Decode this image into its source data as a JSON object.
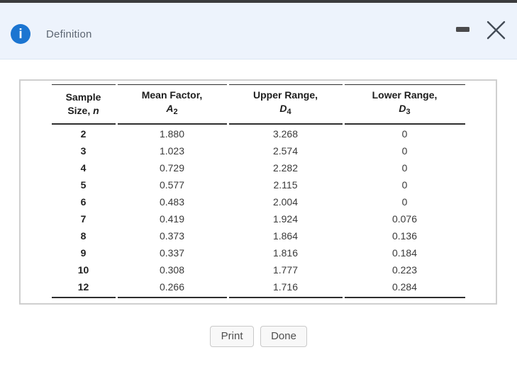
{
  "dialog": {
    "title": "Definition"
  },
  "window_controls": {
    "minimize_icon": "minimize-dash",
    "close_icon": "close-x"
  },
  "buttons": {
    "print_label": "Print",
    "done_label": "Done"
  },
  "colors": {
    "accent_blue": "#1b75d1",
    "header_band": "#edf3fc",
    "top_bar": "#3b3b3d",
    "table_rule": "#2e2e2e",
    "panel_border": "#cfcfcf",
    "button_text": "#4f4f4f"
  },
  "table": {
    "columns": [
      {
        "line1": "Sample",
        "line2_text": "Size, ",
        "symbol": "n",
        "subscript": ""
      },
      {
        "line1": "Mean Factor,",
        "line2_text": "",
        "symbol": "A",
        "subscript": "2"
      },
      {
        "line1": "Upper Range,",
        "line2_text": "",
        "symbol": "D",
        "subscript": "4"
      },
      {
        "line1": "Lower Range,",
        "line2_text": "",
        "symbol": "D",
        "subscript": "3"
      }
    ],
    "rows": [
      [
        "2",
        "1.880",
        "3.268",
        "0"
      ],
      [
        "3",
        "1.023",
        "2.574",
        "0"
      ],
      [
        "4",
        "0.729",
        "2.282",
        "0"
      ],
      [
        "5",
        "0.577",
        "2.115",
        "0"
      ],
      [
        "6",
        "0.483",
        "2.004",
        "0"
      ],
      [
        "7",
        "0.419",
        "1.924",
        "0.076"
      ],
      [
        "8",
        "0.373",
        "1.864",
        "0.136"
      ],
      [
        "9",
        "0.337",
        "1.816",
        "0.184"
      ],
      [
        "10",
        "0.308",
        "1.777",
        "0.223"
      ],
      [
        "12",
        "0.266",
        "1.716",
        "0.284"
      ]
    ]
  }
}
